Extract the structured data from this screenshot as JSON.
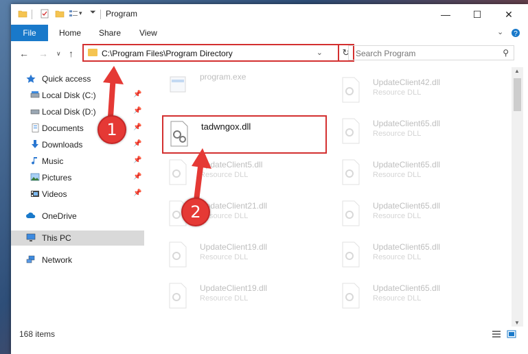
{
  "window": {
    "title": "Program",
    "minimize_label": "—",
    "maximize_label": "☐",
    "close_label": "✕"
  },
  "ribbon": {
    "tabs": [
      "File",
      "Home",
      "Share",
      "View"
    ],
    "expand_icon": "chevron-down-icon",
    "help_icon": "help-icon"
  },
  "address_bar": {
    "path": "C:\\Program Files\\Program Directory",
    "refresh_symbol": "↻"
  },
  "search": {
    "placeholder": "Search Program"
  },
  "nav_pane": {
    "items": [
      {
        "label": "Quick access",
        "icon": "star-icon"
      },
      {
        "label": "Local Disk (C:)",
        "icon": "drive-icon",
        "pinned": true
      },
      {
        "label": "Local Disk (D:)",
        "icon": "drive-icon",
        "pinned": true
      },
      {
        "label": "Documents",
        "icon": "documents-icon",
        "pinned": true
      },
      {
        "label": "Downloads",
        "icon": "download-icon",
        "pinned": true
      },
      {
        "label": "Music",
        "icon": "music-icon",
        "pinned": true
      },
      {
        "label": "Pictures",
        "icon": "pictures-icon",
        "pinned": true
      },
      {
        "label": "Videos",
        "icon": "videos-icon",
        "pinned": true
      },
      {
        "label": "OneDrive",
        "icon": "cloud-icon"
      },
      {
        "label": "This PC",
        "icon": "computer-icon",
        "selected": true
      },
      {
        "label": "Network",
        "icon": "network-icon"
      }
    ]
  },
  "files": {
    "left_column": [
      {
        "name": "program.exe",
        "type": ""
      },
      {
        "name": "tadwngox.dll",
        "type": "",
        "highlighted": true
      },
      {
        "name": "UpdateClient5.dll",
        "type": "Resource DLL"
      },
      {
        "name": "UpdateClient21.dll",
        "type": "Resource DLL"
      },
      {
        "name": "UpdateClient19.dll",
        "type": "Resource DLL"
      },
      {
        "name": "UpdateClient19.dll",
        "type": "Resource DLL"
      }
    ],
    "right_column": [
      {
        "name": "UpdateClient42.dll",
        "type": "Resource DLL"
      },
      {
        "name": "UpdateClient65.dll",
        "type": "Resource DLL"
      },
      {
        "name": "UpdateClient65.dll",
        "type": "Resource DLL"
      },
      {
        "name": "UpdateClient65.dll",
        "type": "Resource DLL"
      },
      {
        "name": "UpdateClient65.dll",
        "type": "Resource DLL"
      },
      {
        "name": "UpdateClient65.dll",
        "type": "Resource DLL"
      }
    ]
  },
  "status_bar": {
    "item_count": "168 items"
  },
  "annotations": {
    "step1": "1",
    "step2": "2",
    "color": "#e53935"
  }
}
